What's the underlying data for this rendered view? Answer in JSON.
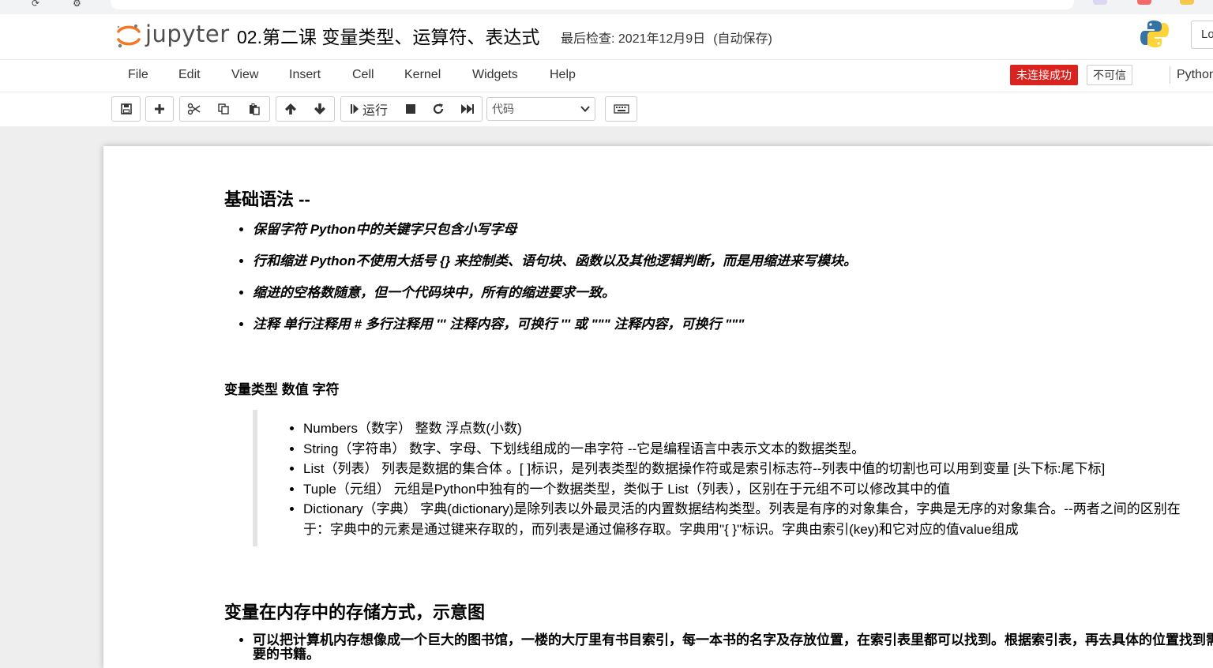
{
  "header": {
    "logo_text": "jupyter",
    "notebook_title": "02.第二课 变量类型、运算符、表达式",
    "checkpoint_label": "最后检查: 2021年12月9日",
    "autosave_label": "(自动保存)",
    "logout_label": "Lo"
  },
  "menu": {
    "items": [
      "File",
      "Edit",
      "View",
      "Insert",
      "Cell",
      "Kernel",
      "Widgets",
      "Help"
    ],
    "kernel_status": "未连接成功",
    "trust_label": "不可信",
    "kernel_name": "Python"
  },
  "toolbar": {
    "run_label": "运行",
    "cell_type": "代码",
    "icons": [
      "save-icon",
      "plus-icon",
      "cut-icon",
      "copy-icon",
      "paste-icon",
      "arrow-up-icon",
      "arrow-down-icon",
      "run-icon",
      "stop-icon",
      "restart-icon",
      "fast-forward-icon",
      "keyboard-icon"
    ]
  },
  "cells": {
    "basic_heading": "基础语法 --",
    "basic_items": [
      "保留字符 Python中的关键字只包含小写字母",
      "行和缩进 Python不使用大括号 {} 来控制类、语句块、函数以及其他逻辑判断，而是用缩进来写模块。",
      "缩进的空格数随意，但一个代码块中，所有的缩进要求一致。",
      "注释 单行注释用 # 多行注释用 ''' 注释内容，可换行 ''' 或 \"\"\" 注释内容，可换行 \"\"\""
    ],
    "var_heading": "变量类型 数值 字符",
    "var_items": [
      "Numbers（数字） 整数 浮点数(小数)",
      "String（字符串） 数字、字母、下划线组成的一串字符 --它是编程语言中表示文本的数据类型。",
      "List（列表） 列表是数据的集合体 。[ ]标识，是列表类型的数据操作符或是索引标志符--列表中值的切割也可以用到变量 [头下标:尾下标]",
      "Tuple（元组） 元组是Python中独有的一个数据类型，类似于 List（列表），区别在于元组不可以修改其中的值",
      "Dictionary（字典） 字典(dictionary)是除列表以外最灵活的内置数据结构类型。列表是有序的对象集合，字典是无序的对象集合。--两者之间的区别在于：字典中的元素是通过键来存取的，而列表是通过偏移存取。字典用\"{ }\"标识。字典由索引(key)和它对应的值value组成"
    ],
    "mem_heading": "变量在内存中的存储方式，示意图",
    "mem_items": [
      "可以把计算机内存想像成一个巨大的图书馆，一楼的大厅里有书目索引，每一本书的名字及存放位置，在索引表里都可以找到。根据索引表，再去具体的位置找到需要的书籍。"
    ]
  },
  "colors": {
    "accent_orange": "#f37726",
    "kernel_error": "#d9231f",
    "background": "#eeeeee"
  }
}
